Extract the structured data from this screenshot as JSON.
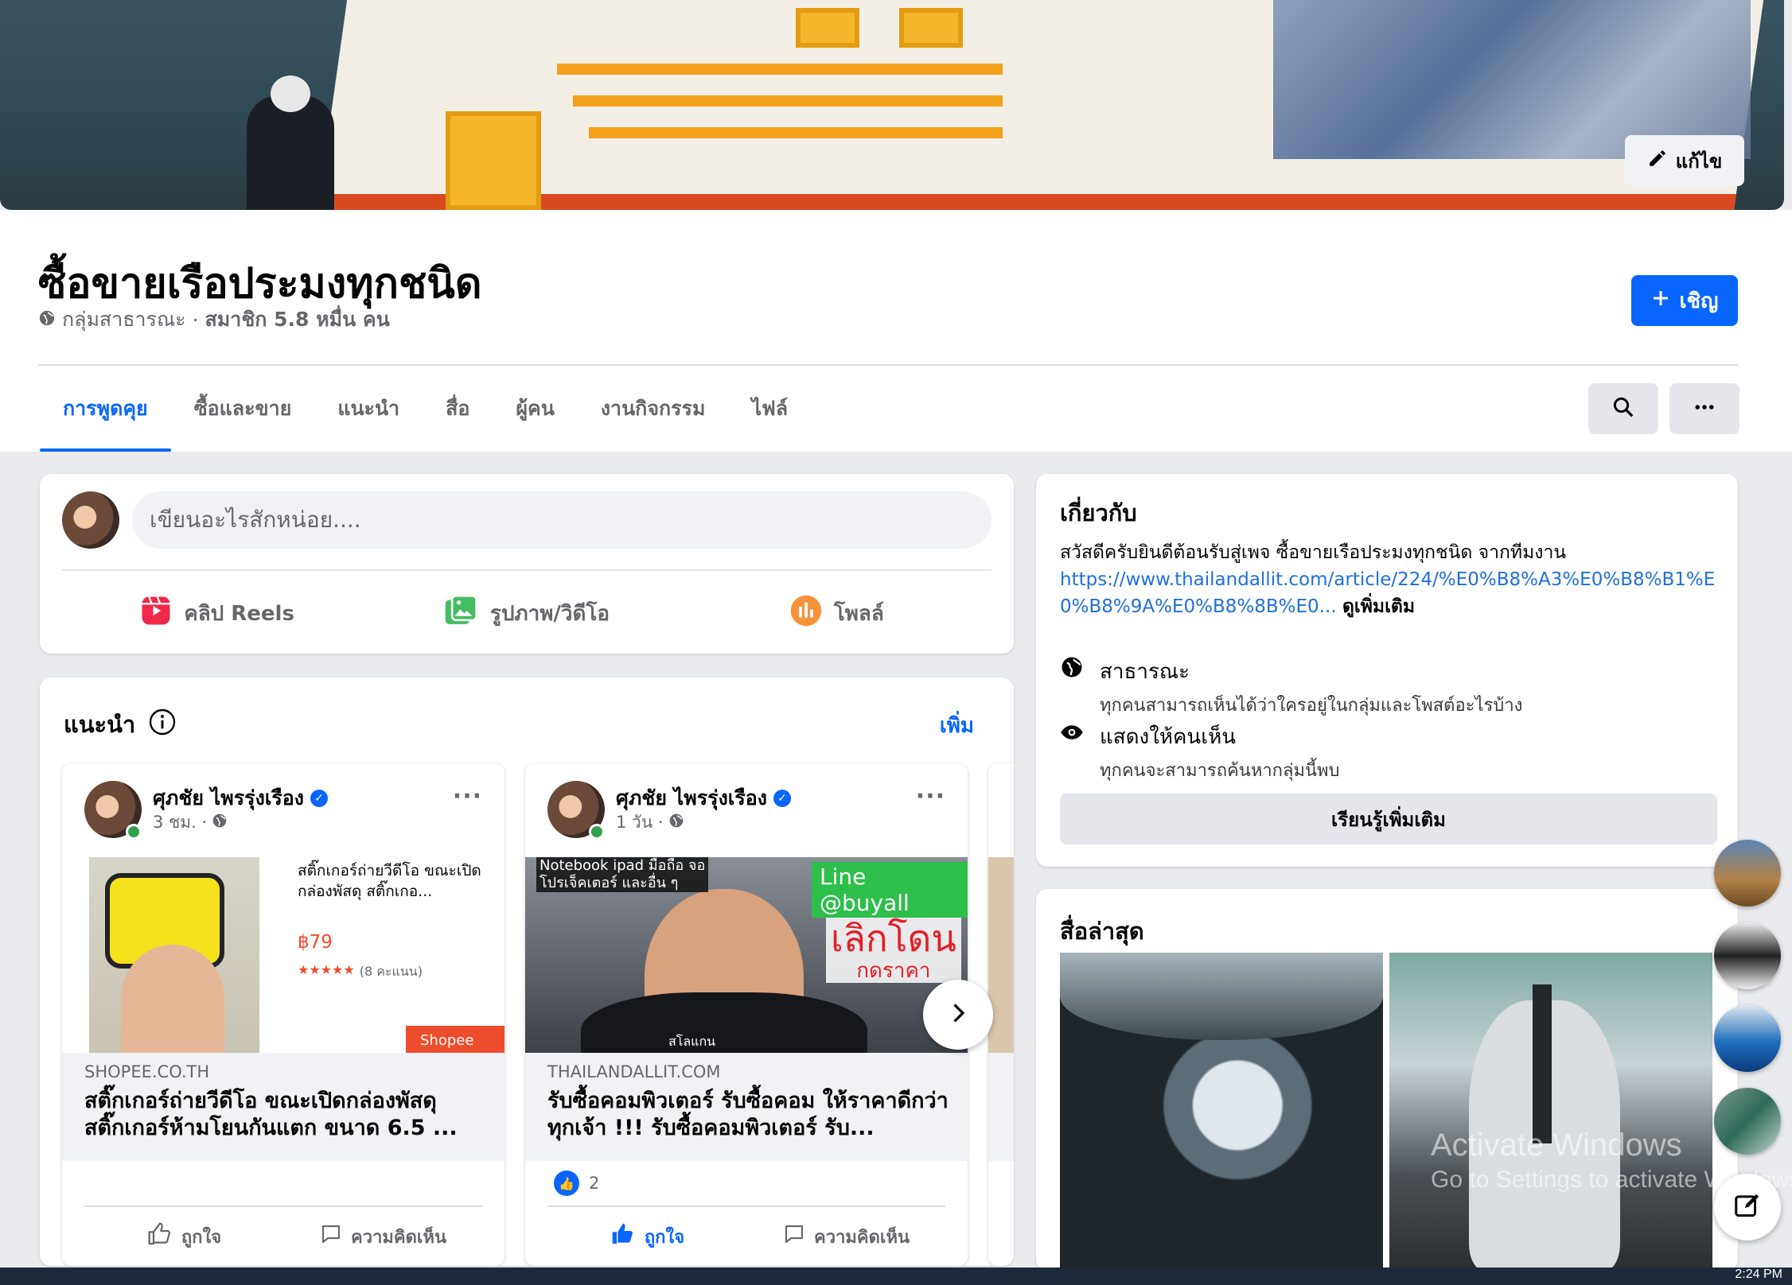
{
  "cover": {
    "edit_label": "แก้ไข"
  },
  "group": {
    "title": "ซื้อขายเรือประมงทุกชนิด",
    "privacy": "กลุ่มสาธารณะ",
    "members": "สมาชิก 5.8 หมื่น คน",
    "invite_label": "เชิญ"
  },
  "tabs": [
    {
      "label": "การพูดคุย",
      "active": true
    },
    {
      "label": "ซื้อและขาย"
    },
    {
      "label": "แนะนำ"
    },
    {
      "label": "สื่อ"
    },
    {
      "label": "ผู้คน"
    },
    {
      "label": "งานกิจกรรม"
    },
    {
      "label": "ไฟล์"
    }
  ],
  "composer": {
    "placeholder": "เขียนอะไรสักหน่อย....",
    "actions": [
      "คลิป Reels",
      "รูปภาพ/วิดีโอ",
      "โพลล์"
    ]
  },
  "suggest": {
    "title": "แนะนำ",
    "more": "เพิ่ม",
    "posts": [
      {
        "author": "ศุภชัย ไพรรุ่งเรือง",
        "time": "3 ชม. ·",
        "product_title": "สติ๊กเกอร์ถ่ายวีดีโอ ขณะเปิดกล่องพัสดุ สติ๊กเกอ...",
        "price": "฿79",
        "rating_stars": "★★★★★",
        "rating_count": "(8 คะแนน)",
        "badge": "Shopee",
        "domain": "SHOPEE.CO.TH",
        "headline": "สติ๊กเกอร์ถ่ายวีดีโอ ขณะเปิดกล่องพัสดุ สติ๊กเกอร์ห้ามโยนกันแตก ขนาด 6.5 ...",
        "like": "ถูกใจ",
        "comment": "ความคิดเห็น"
      },
      {
        "author": "ศุภชัย ไพรรุ่งเรือง",
        "time": "1 วัน ·",
        "overlay_top": "Notebook ipad มือถือ จอ",
        "overlay_top2": "โปรเจ็คเตอร์ และอื่น ๆ",
        "overlay_line": "Line @buyall",
        "overlay_big": "เลิกโดน",
        "overlay_big2": "กดราคา",
        "overlay_bottom": "สโลแกน",
        "domain": "THAILANDALLIT.COM",
        "headline": "รับซื้อคอมพิวเตอร์ รับซื้อคอม ให้ราคาดีกว่าทุกเจ้า !!! รับซื้อคอมพิวเตอร์ รับ...",
        "reactions": "2",
        "like": "ถูกใจ",
        "comment": "ความคิดเห็น"
      }
    ]
  },
  "about": {
    "title": "เกี่ยวกับ",
    "text": "สวัสดีครับยินดีต้อนรับสู่เพจ ซื้อขายเรือประมงทุกชนิด จากทีมงาน",
    "link": "https://www.thailandallit.com/article/224/%E0%B8%A3%E0%B8%B1%E0%B8%9A%E0%B8%8B%E0...",
    "see_more": "ดูเพิ่มเติม",
    "public_title": "สาธารณะ",
    "public_desc": "ทุกคนสามารถเห็นได้ว่าใครอยู่ในกลุ่มและโพสต์อะไรบ้าง",
    "visible_title": "แสดงให้คนเห็น",
    "visible_desc": "ทุกคนจะสามารถค้นหากลุ่มนี้พบ",
    "learn_more": "เรียนรู้เพิ่มเติม"
  },
  "media": {
    "title": "สื่อล่าสุด"
  },
  "watermark": {
    "line1": "Activate Windows",
    "line2": "Go to Settings to activate Windows."
  },
  "taskbar": {
    "clock": "2:24 PM"
  },
  "colors": {
    "accent": "#0866ff",
    "bg": "#e9ebee"
  }
}
